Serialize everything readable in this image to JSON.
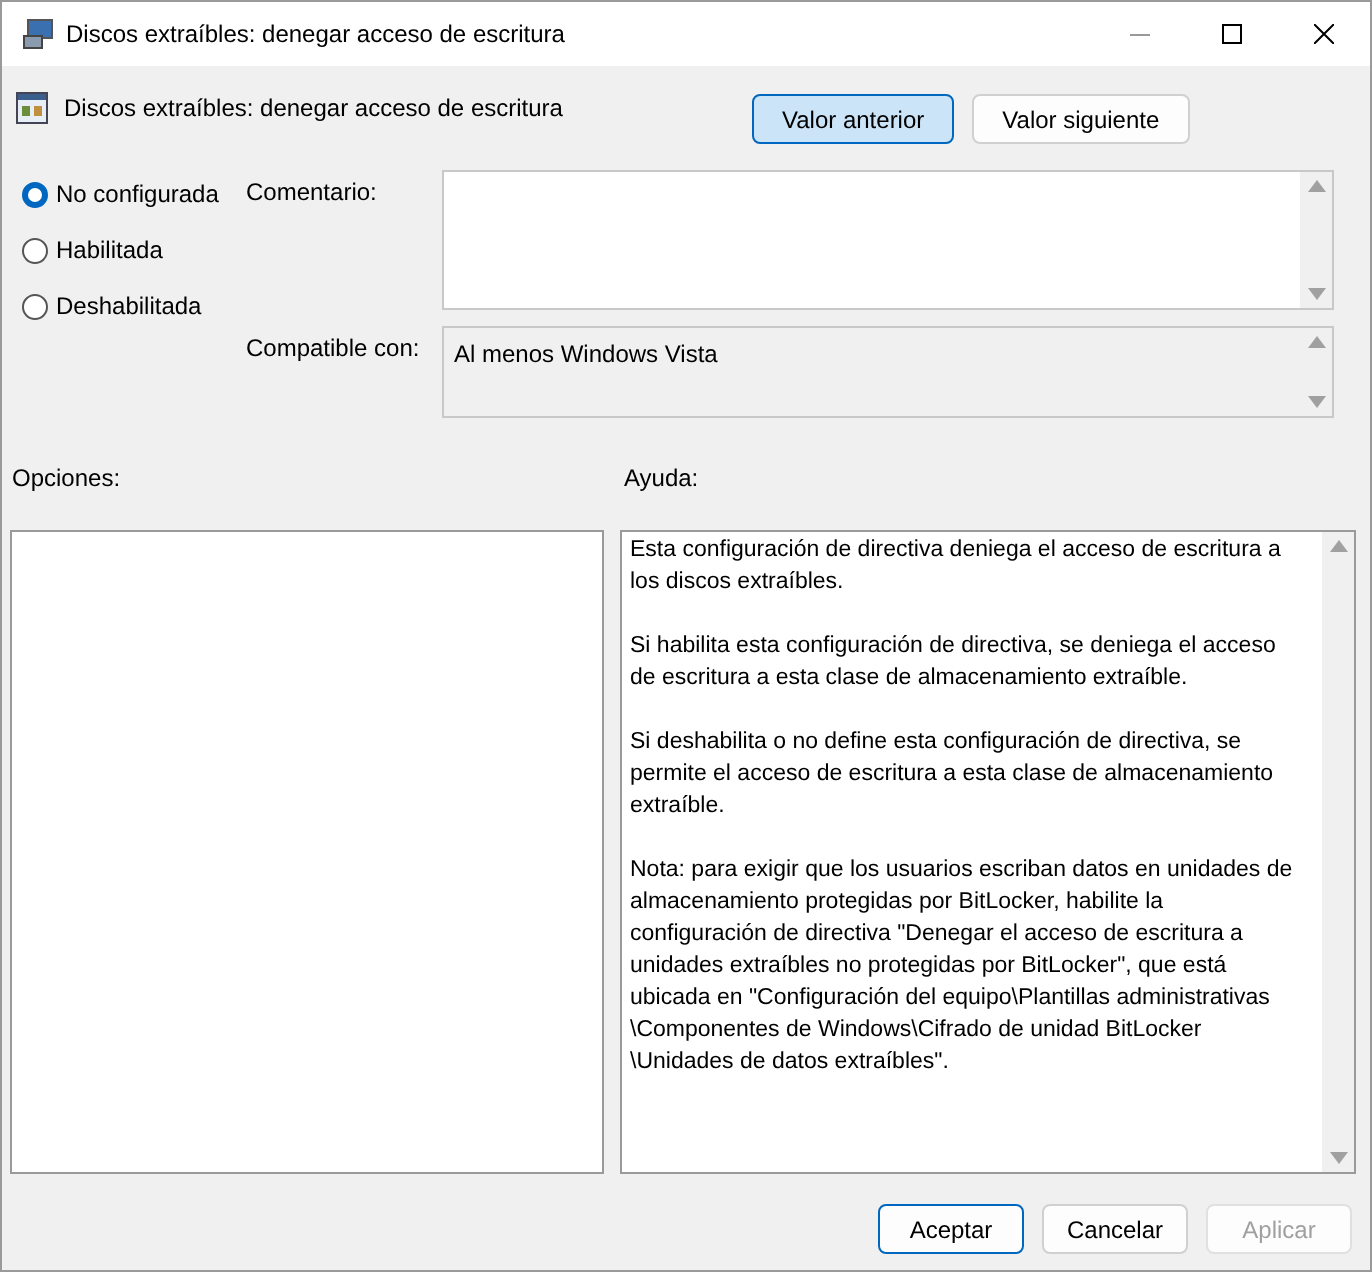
{
  "window": {
    "title": "Discos extraíbles: denegar acceso de escritura"
  },
  "setting": {
    "title": "Discos extraíbles: denegar acceso de escritura"
  },
  "nav_buttons": [
    {
      "label": "Valor anterior",
      "selected": true
    },
    {
      "label": "Valor siguiente",
      "selected": false
    }
  ],
  "state_options": [
    {
      "label": "No configurada",
      "selected": true
    },
    {
      "label": "Habilitada",
      "selected": false
    },
    {
      "label": "Deshabilitada",
      "selected": false
    }
  ],
  "comment": {
    "label": "Comentario:"
  },
  "compatible": {
    "label": "Compatible con:",
    "value": "Al menos Windows Vista"
  },
  "options": {
    "label": "Opciones:"
  },
  "help": {
    "label": "Ayuda:",
    "paragraphs": [
      "Esta configuración de directiva deniega el acceso de escritura a\nlos discos extraíbles.",
      "Si habilita esta configuración de directiva, se deniega el acceso\nde escritura a esta clase de almacenamiento extraíble.",
      "Si deshabilita o no define esta configuración de directiva, se\npermite el acceso de escritura a esta clase de almacenamiento\nextraíble.",
      "Nota: para exigir que los usuarios escriban datos en unidades de\nalmacenamiento protegidas por BitLocker, habilite la\nconfiguración de directiva \"Denegar el acceso de escritura a\nunidades extraíbles no protegidas por BitLocker\", que está\nubicada en \"Configuración del equipo\\Plantillas administrativas\n\\Componentes de Windows\\Cifrado de unidad BitLocker\n\\Unidades de datos extraíbles\"."
    ]
  },
  "footer_buttons": [
    {
      "label": "Aceptar",
      "kind": "default",
      "disabled": false
    },
    {
      "label": "Cancelar",
      "kind": "normal",
      "disabled": false
    },
    {
      "label": "Aplicar",
      "kind": "normal",
      "disabled": true
    }
  ]
}
